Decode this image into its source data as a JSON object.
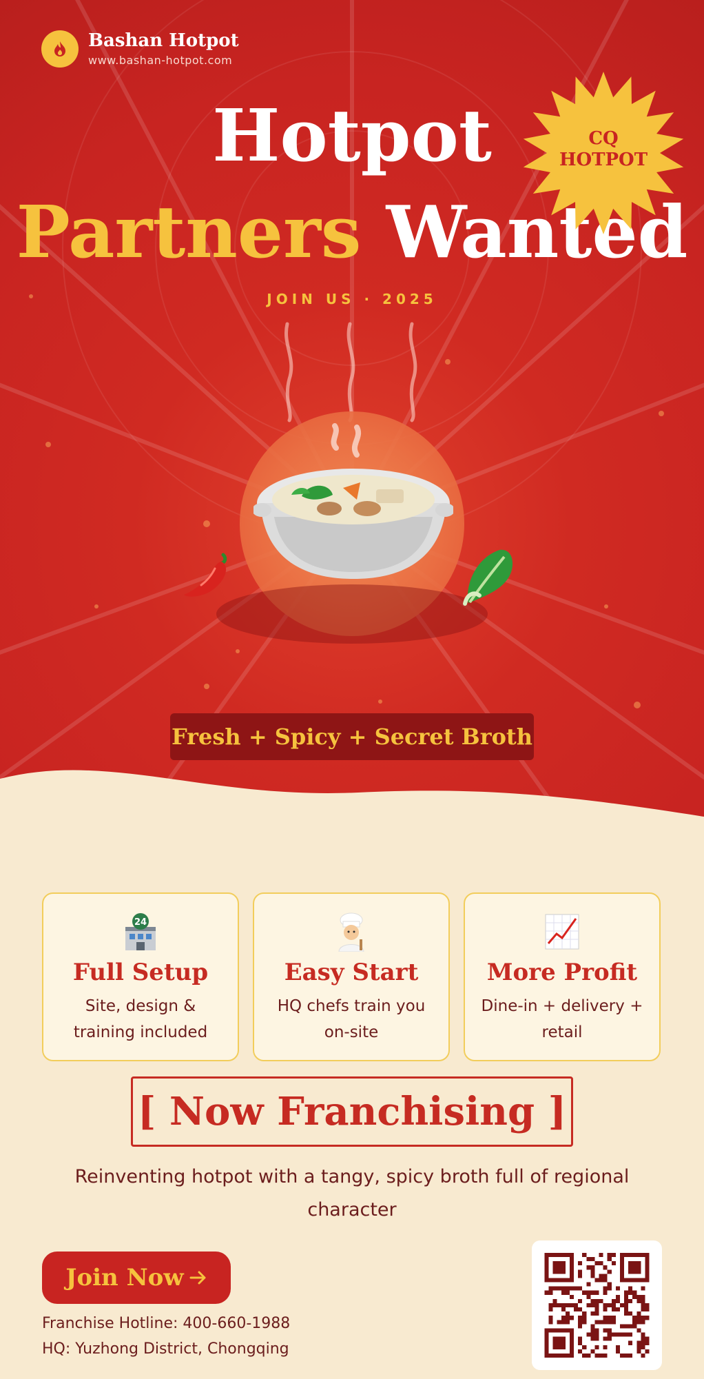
{
  "brand": {
    "name": "Bashan Hotpot",
    "url": "www.bashan-hotpot.com",
    "logo_icon": "flame-icon"
  },
  "hero": {
    "title_line1": "Hotpot",
    "title_line2_gold": "Partners",
    "title_line2_white": "Wanted",
    "subtitle": "JOIN US · 2025",
    "badge_line1": "CQ",
    "badge_line2": "HOTPOT",
    "tagline": "Fresh + Spicy + Secret Broth",
    "illustration_icons": [
      "hotpot-bowl-icon",
      "chili-pepper-icon",
      "bok-choy-icon"
    ]
  },
  "features": [
    {
      "icon": "building-24-icon",
      "title": "Full Setup",
      "desc": "Site, design & training included"
    },
    {
      "icon": "chef-icon",
      "title": "Easy Start",
      "desc": "HQ chefs train you on-site"
    },
    {
      "icon": "chart-up-icon",
      "title": "More Profit",
      "desc": "Dine-in + delivery + retail"
    }
  ],
  "franchise": {
    "heading": "[ Now Franchising ]",
    "description": "Reinventing hotpot with a tangy, spicy broth full of regional character"
  },
  "cta": {
    "join_label": "Join Now",
    "join_icon": "arrow-right-icon"
  },
  "contact": {
    "hotline": "Franchise Hotline: 400-660-1988",
    "hq": "HQ: Yuzhong District, Chongqing"
  },
  "qr": {
    "icon": "qr-code-icon"
  },
  "colors": {
    "red": "#c82421",
    "dark_red": "#8e1515",
    "gold": "#f6c23e",
    "cream": "#f8ead0",
    "text_brown": "#6b1d1d"
  }
}
